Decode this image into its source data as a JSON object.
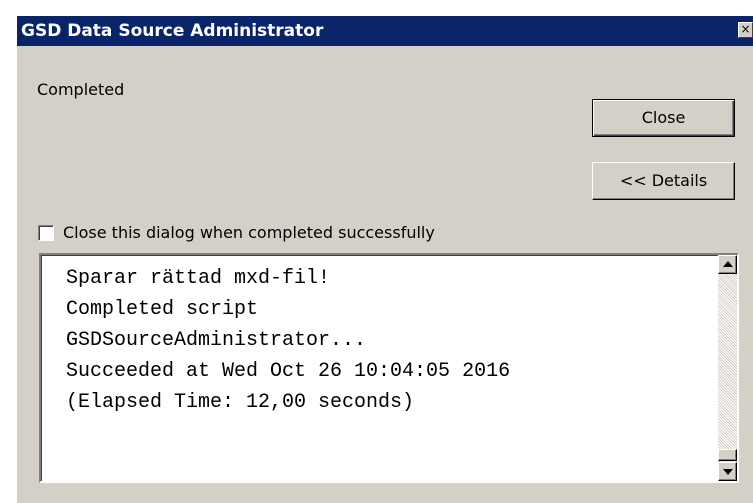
{
  "window": {
    "title": "GSD Data Source Administrator",
    "close_glyph": "×"
  },
  "status": {
    "text": "Completed"
  },
  "buttons": {
    "close_label": "Close",
    "details_label": "<< Details"
  },
  "options": {
    "close_when_done_label": "Close this dialog when completed successfully",
    "close_when_done_checked": false
  },
  "log": {
    "lines": [
      "Sparar rättad mxd-fil!",
      "Completed script",
      "GSDSourceAdministrator...",
      "Succeeded at Wed Oct 26 10:04:05 2016",
      "(Elapsed Time: 12,00 seconds)"
    ]
  },
  "colors": {
    "titlebar": "#0a246a",
    "face": "#d4d0c8"
  },
  "icons": {
    "scroll_up": "arrow-up-icon",
    "scroll_down": "arrow-down-icon",
    "title_close": "close-icon"
  }
}
